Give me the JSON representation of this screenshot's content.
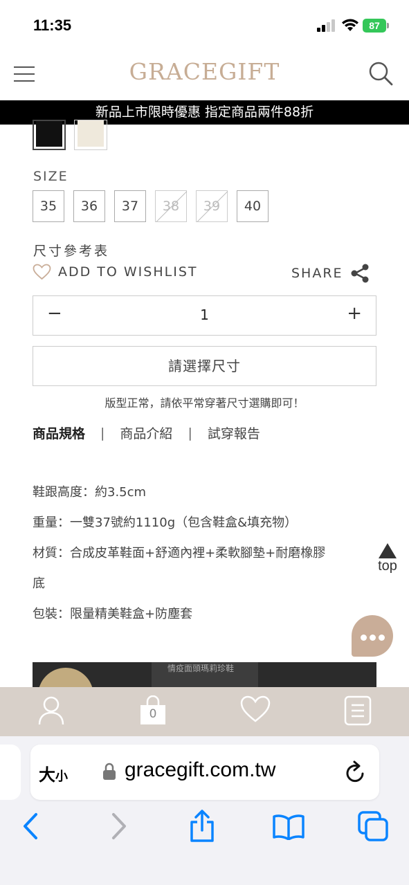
{
  "status_bar": {
    "time": "11:35",
    "battery": "87"
  },
  "header": {
    "brand": "GRACEGIFT"
  },
  "promo": {
    "text": "新品上市限時優惠 指定商品兩件88折"
  },
  "size": {
    "label": "SIZE",
    "options": [
      {
        "label": "35",
        "available": true
      },
      {
        "label": "36",
        "available": true
      },
      {
        "label": "37",
        "available": true
      },
      {
        "label": "38",
        "available": false
      },
      {
        "label": "39",
        "available": false
      },
      {
        "label": "40",
        "available": true
      }
    ],
    "chart_link": "尺寸參考表"
  },
  "actions": {
    "wishlist": "ADD TO WISHLIST",
    "share": "SHARE"
  },
  "quantity": {
    "minus": "−",
    "value": "1",
    "plus": "+"
  },
  "select_size_button": "請選擇尺寸",
  "fit_note": "版型正常，請依平常穿著尺寸選購即可！",
  "tabs": [
    {
      "label": "商品規格",
      "active": true
    },
    {
      "label": "商品介紹",
      "active": false
    },
    {
      "label": "試穿報告",
      "active": false
    }
  ],
  "tab_separator": "|",
  "specs": [
    "鞋跟高度：約3.5cm",
    "重量：一雙37號約1110g（包含鞋盒&填充物）",
    "材質：合成皮革鞋面+舒適內裡+柔軟腳墊+耐磨橡膠",
    "底",
    "包裝：限量精美鞋盒+防塵套"
  ],
  "top_button": "top",
  "banner_text": "情疫面頭瑪莉珍鞋",
  "bottom_nav": {
    "cart_count": "0"
  },
  "browser": {
    "text_size_big": "大",
    "text_size_small": "小",
    "url": "gracegift.com.tw"
  },
  "colors": {
    "brand": "#c7ad95",
    "promo_bg": "#000000",
    "nav_bg": "#d8d0c9",
    "chat_bg": "#c9ad98",
    "ios_blue": "#0a84ff"
  }
}
